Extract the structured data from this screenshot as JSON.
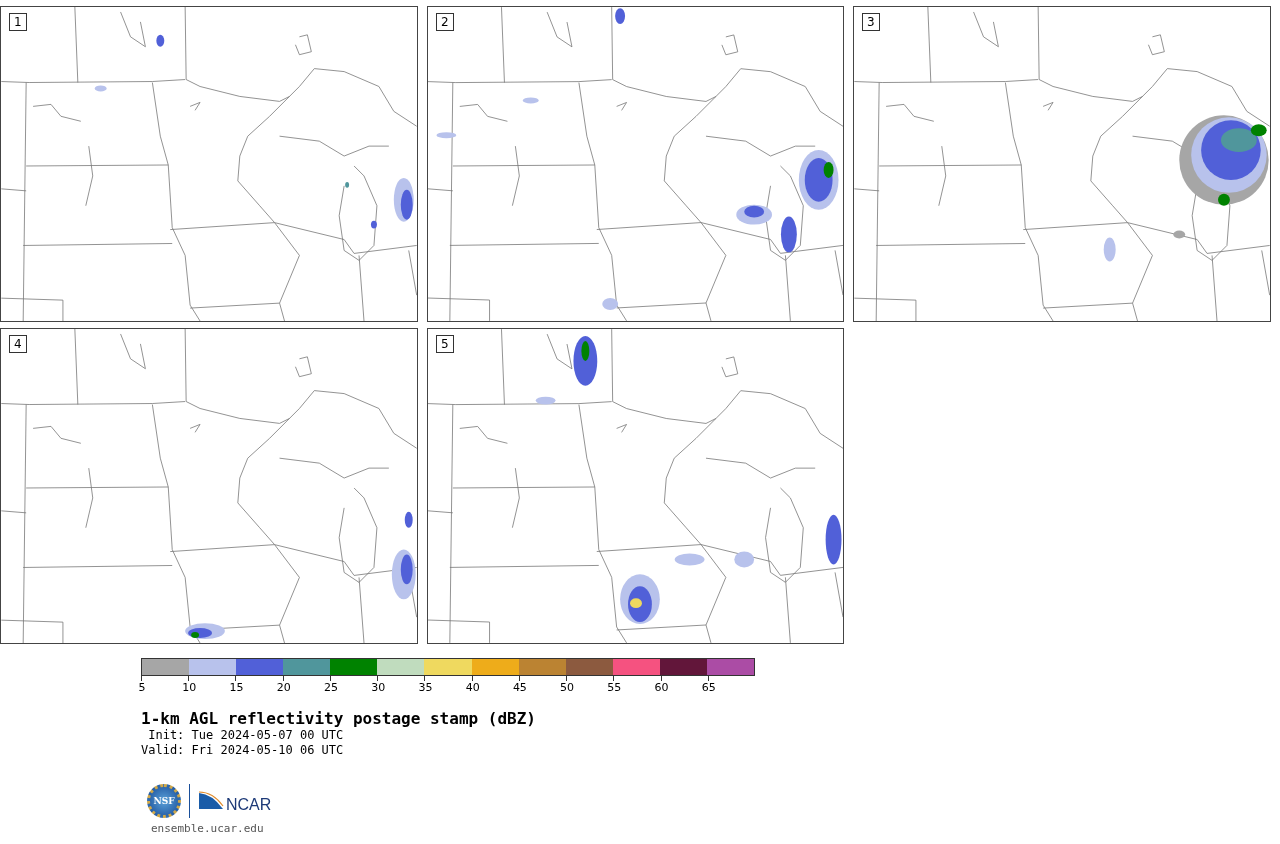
{
  "panels": [
    {
      "label": "1"
    },
    {
      "label": "2"
    },
    {
      "label": "3"
    },
    {
      "label": "4"
    },
    {
      "label": "5"
    }
  ],
  "colorbar": {
    "bins": [
      {
        "color": "#a6a6a6"
      },
      {
        "color": "#b8c2ec"
      },
      {
        "color": "#5160d8"
      },
      {
        "color": "#50969c"
      },
      {
        "color": "#008200"
      },
      {
        "color": "#c0dcbe"
      },
      {
        "color": "#efd95f"
      },
      {
        "color": "#eeac1a"
      },
      {
        "color": "#bb8332"
      },
      {
        "color": "#8c5a3f"
      },
      {
        "color": "#f55280"
      },
      {
        "color": "#62163a"
      },
      {
        "color": "#ab4ca5"
      }
    ],
    "ticks": [
      "5",
      "10",
      "15",
      "20",
      "25",
      "30",
      "35",
      "40",
      "45",
      "50",
      "55",
      "60",
      "65"
    ]
  },
  "title": "1-km AGL reflectivity postage stamp (dBZ)",
  "init": " Init: Tue 2024-05-07 00 UTC",
  "valid": "Valid: Fri 2024-05-10 06 UTC",
  "logos": {
    "nsf": "NSF",
    "ncar": "NCAR"
  },
  "url": "ensemble.ucar.edu"
}
